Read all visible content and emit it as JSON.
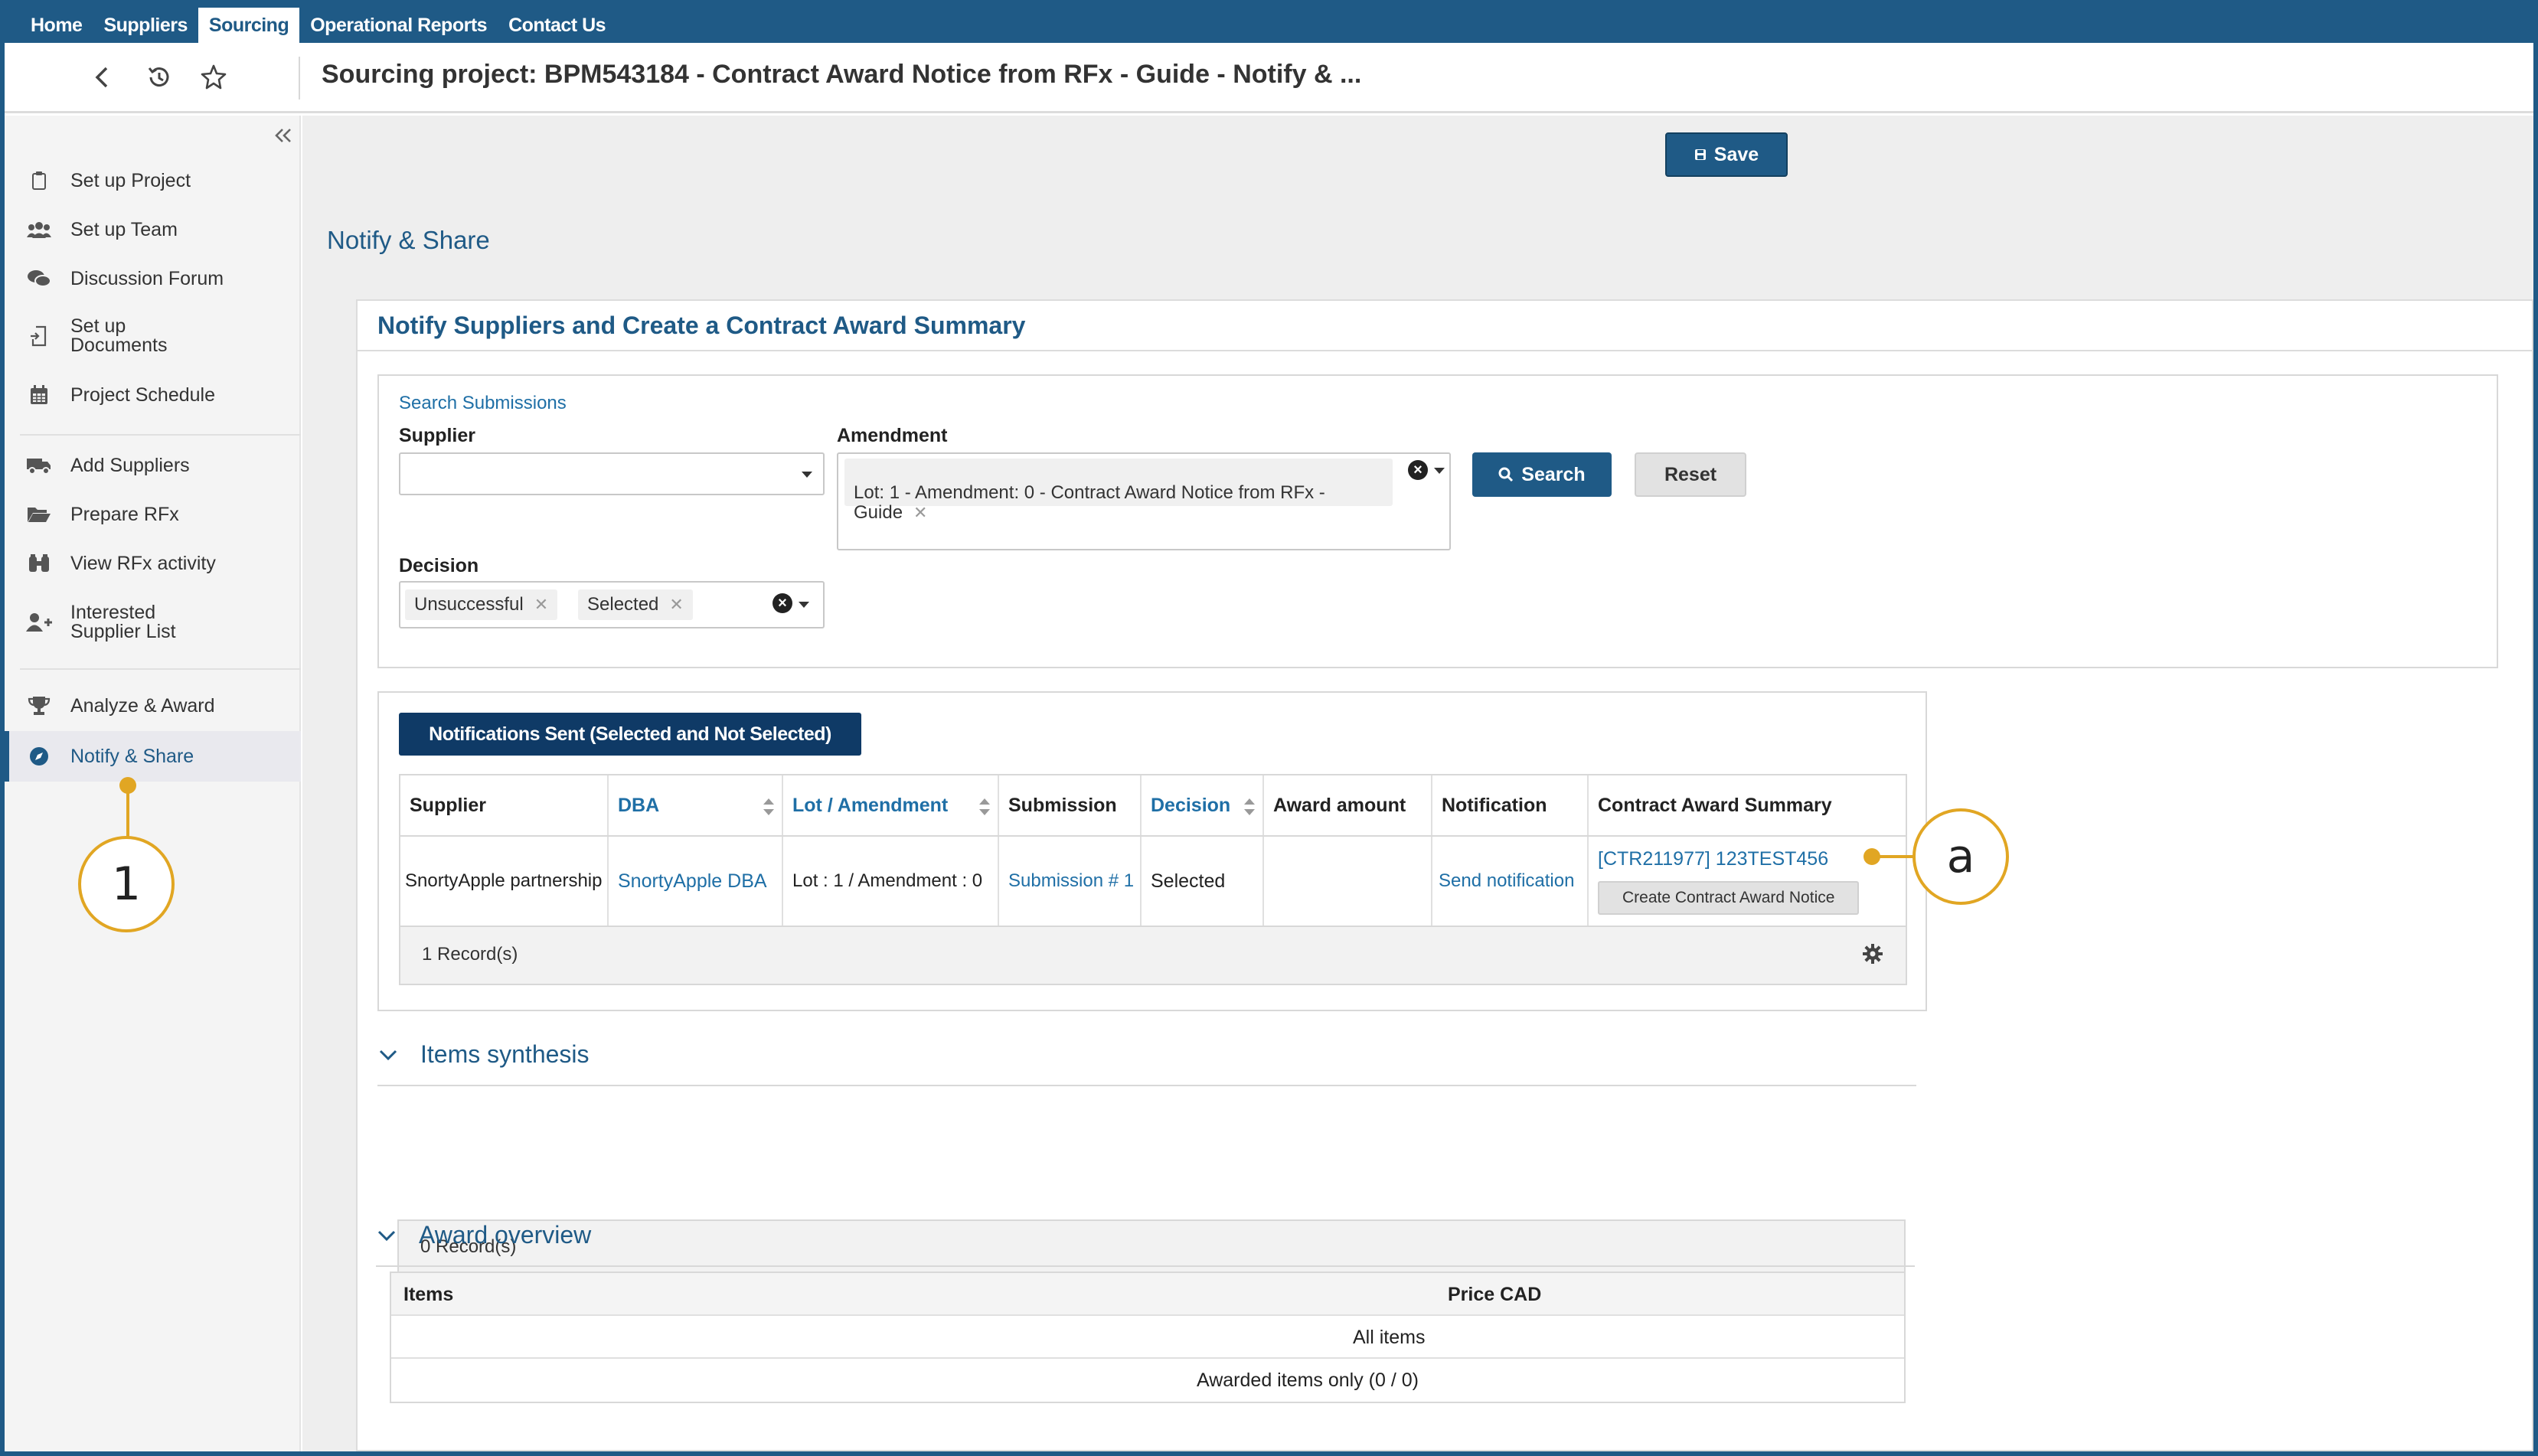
{
  "nav": {
    "items": [
      "Home",
      "Suppliers",
      "Sourcing",
      "Operational Reports",
      "Contact Us"
    ],
    "active": "Sourcing"
  },
  "titlebar": {
    "title": "Sourcing project: BPM543184 - Contract Award Notice from RFx - Guide - Notify & ..."
  },
  "sidebar": {
    "items": [
      {
        "label": "Set up Project",
        "icon": "clipboard-icon"
      },
      {
        "label": "Set up Team",
        "icon": "team-icon"
      },
      {
        "label": "Discussion Forum",
        "icon": "chat-icon"
      },
      {
        "label": "Set up\nDocuments",
        "icon": "document-import-icon"
      },
      {
        "label": "Project Schedule",
        "icon": "calendar-icon"
      },
      {
        "label": "Add Suppliers",
        "icon": "truck-icon"
      },
      {
        "label": "Prepare RFx",
        "icon": "folder-open-icon"
      },
      {
        "label": "View RFx activity",
        "icon": "binoculars-icon"
      },
      {
        "label": "Interested\nSupplier List",
        "icon": "user-plus-icon"
      },
      {
        "label": "Analyze & Award",
        "icon": "trophy-icon"
      },
      {
        "label": "Notify & Share",
        "icon": "compass-icon"
      }
    ],
    "active_index": 10
  },
  "toolbar": {
    "save_label": "Save"
  },
  "section": {
    "title": "Notify & Share"
  },
  "card": {
    "title": "Notify Suppliers and Create a Contract Award Summary"
  },
  "search": {
    "title": "Search Submissions",
    "supplier_label": "Supplier",
    "supplier_value": "",
    "amendment_label": "Amendment",
    "amendment_chip": "Lot: 1 - Amendment: 0 - Contract Award Notice from RFx -\nGuide",
    "decision_label": "Decision",
    "decision_chips": [
      "Unsuccessful",
      "Selected"
    ],
    "search_button": "Search",
    "reset_button": "Reset"
  },
  "notifications": {
    "tab_label": "Notifications Sent (Selected and Not Selected)",
    "columns": [
      "Supplier",
      "DBA",
      "Lot / Amendment",
      "Submission",
      "Decision",
      "Award amount",
      "Notification",
      "Contract Award Summary"
    ],
    "rows": [
      {
        "supplier": "SnortyApple partnership",
        "dba": "SnortyApple DBA",
        "lot_amendment": "Lot : 1 / Amendment : 0",
        "submission": "Submission # 1",
        "decision": "Selected",
        "award_amount": "",
        "notification": "Send notification",
        "cas_link": "[CTR211977] 123TEST456",
        "cas_button": "Create Contract Award Notice"
      }
    ],
    "records": "1 Record(s)"
  },
  "items_synthesis": {
    "title": "Items synthesis",
    "records": "0 Record(s)"
  },
  "award_overview": {
    "title": "Award overview",
    "columns": [
      "Items",
      "Price CAD"
    ],
    "rows": [
      "All items",
      "Awarded items only (0 / 0)"
    ]
  },
  "callouts": {
    "one": "1",
    "a": "a"
  },
  "colors": {
    "brand": "#1f5a86",
    "tab_dark": "#0f3a66",
    "link": "#1f6fa6",
    "callout": "#e1a623"
  }
}
